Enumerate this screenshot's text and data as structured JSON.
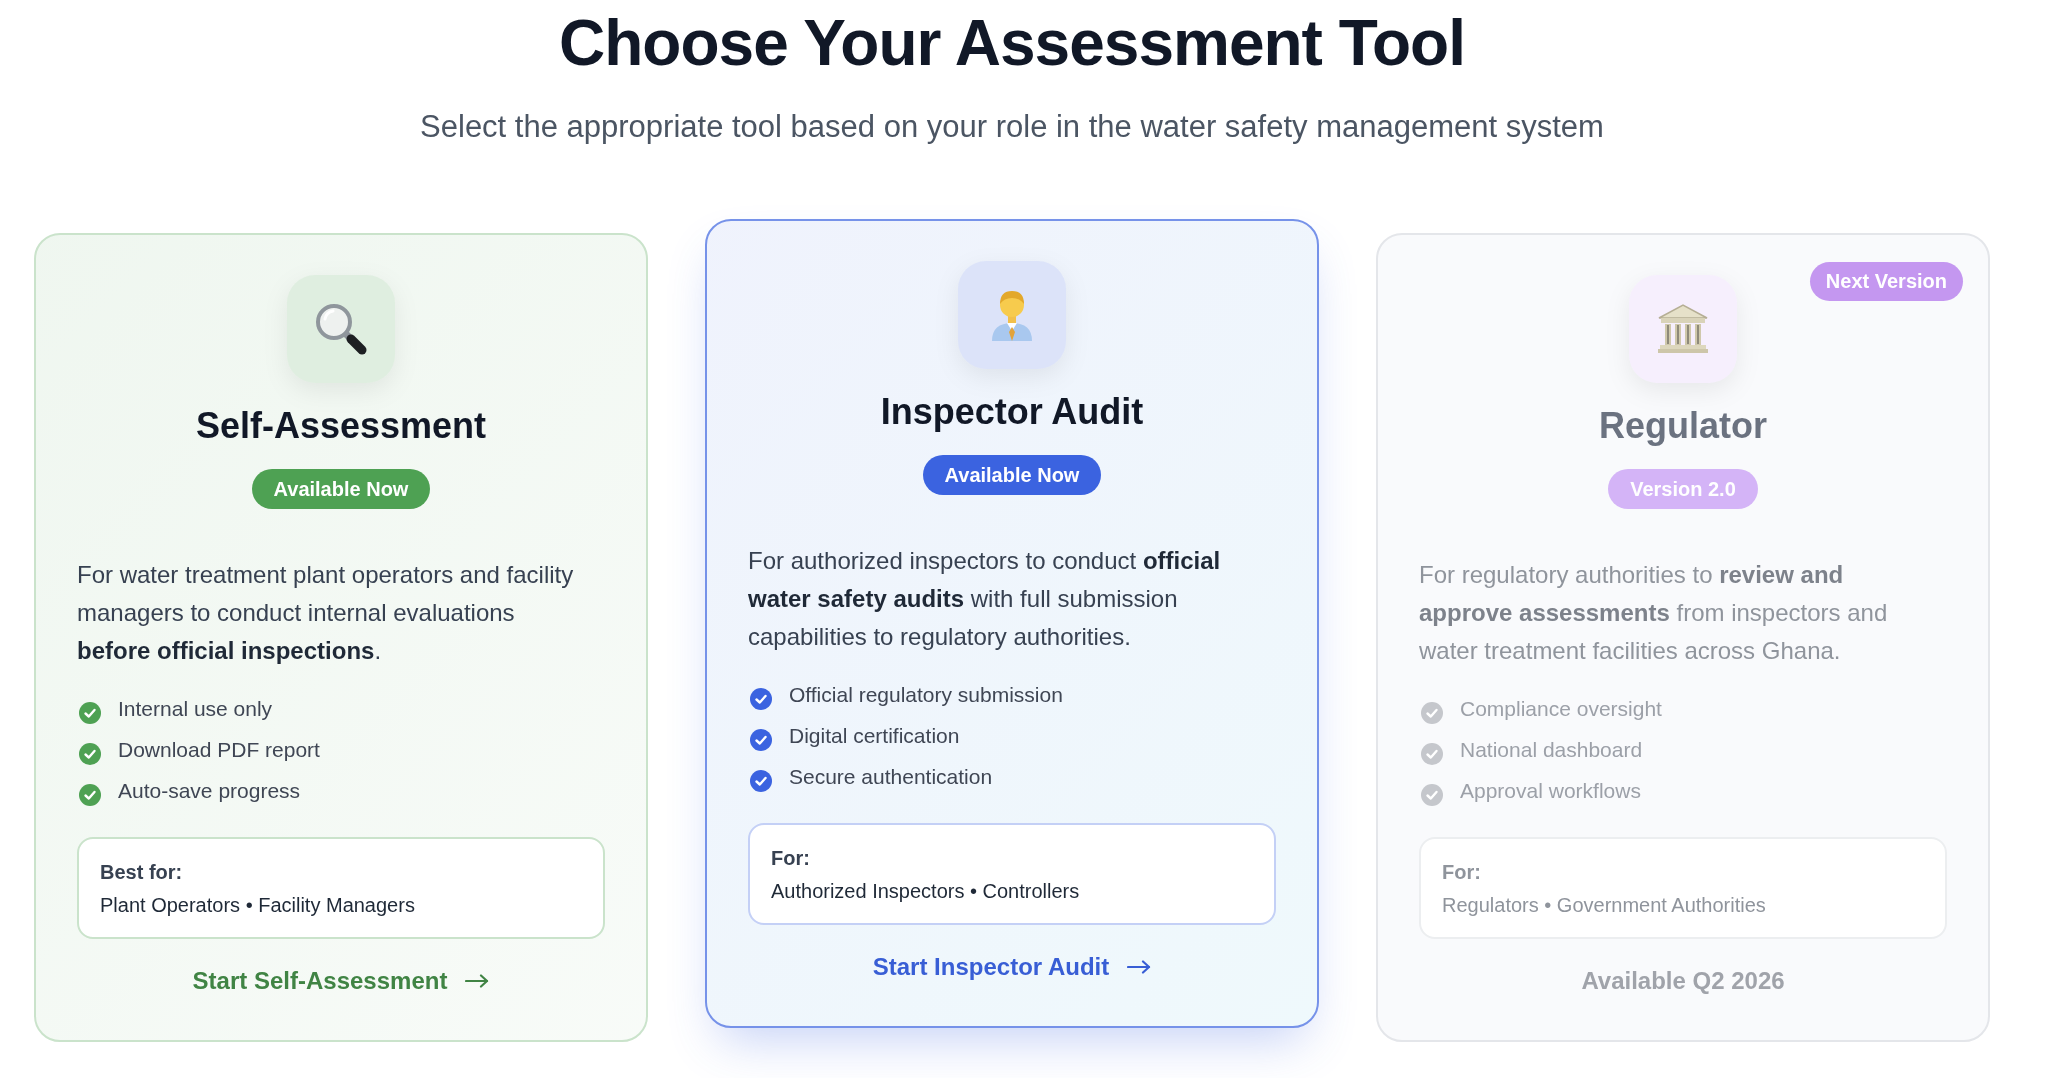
{
  "header": {
    "title": "Choose Your Assessment Tool",
    "subtitle": "Select the appropriate tool based on your role in the water safety management system"
  },
  "cards": [
    {
      "title": "Self-Assessment",
      "color": "#4ea153",
      "featured": false,
      "disabled": false,
      "badge": "Available Now",
      "description": "For water treatment plant operators and facility managers to conduct internal evaluations **before official inspections**.",
      "features": [
        "Internal use only",
        "Download PDF report",
        "Auto-save progress"
      ],
      "audience": {
        "label": "Best for:",
        "value": "Plant Operators • Facility Managers"
      },
      "action": "Start Self-Assessment"
    },
    {
      "title": "Inspector Audit",
      "color": "#3b63e0",
      "featured": true,
      "disabled": false,
      "badge": "Available Now",
      "description": "For authorized inspectors to conduct **official water safety audits** with full submission capabilities to regulatory authorities.",
      "features": [
        "Official regulatory submission",
        "Digital certification",
        "Secure authentication"
      ],
      "audience": {
        "label": "For:",
        "value": "Authorized Inspectors • Controllers"
      },
      "action": "Start Inspector Audit"
    },
    {
      "title": "Regulator",
      "color": "#d4b4f7",
      "featured": false,
      "disabled": true,
      "corner_badge": "Next Version",
      "badge": "Version 2.0",
      "description": "For regulatory authorities to **review and approve assessments** from inspectors and water treatment facilities across Ghana.",
      "features": [
        "Compliance oversight",
        "National dashboard",
        "Approval workflows"
      ],
      "audience": {
        "label": "For:",
        "value": "Regulators • Government Authorities"
      },
      "action": "Available Q2 2026"
    }
  ]
}
